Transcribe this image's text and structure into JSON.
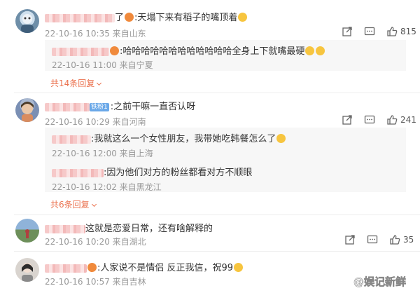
{
  "comments": [
    {
      "text": ":天塌下来有稻子的嘴顶着",
      "meta": "22-10-16 10:35 来自山东",
      "likes": "815",
      "replies": [
        {
          "text": ":哈哈哈哈哈哈哈哈哈哈哈哈全身上下就嘴最硬",
          "meta": "22-10-16 11:00 来自宁夏"
        }
      ],
      "more": "共14条回复"
    },
    {
      "badge": "铁粉1",
      "text": ":之前干嘛一直否认呀",
      "meta": "22-10-16 10:29 来自河南",
      "likes": "241",
      "replies": [
        {
          "text": ":我就这么一个女性朋友，我带她吃韩餐怎么了",
          "meta": "22-10-16 12:00 来自上海"
        },
        {
          "text": ":因为他们对方的粉丝都看对方不顺眼",
          "meta": "22-10-16 12:02 来自黑龙江"
        }
      ],
      "more": "共6条回复"
    },
    {
      "text": "这就是恋爱日常，还有啥解释的",
      "meta": "22-10-16 10:20 来自湖北",
      "likes": "35"
    },
    {
      "text": ":人家说不是情侣 反正我信，祝99",
      "meta": "22-10-16 10:57 来自吉林"
    }
  ],
  "watermark": "@娱记新鲜",
  "icons": [
    "share-icon",
    "comment-icon",
    "like-icon"
  ]
}
